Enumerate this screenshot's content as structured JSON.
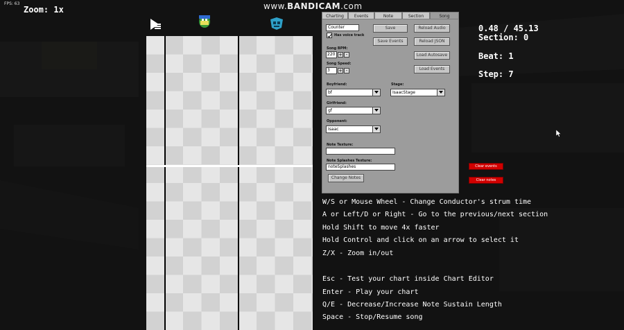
{
  "hud": {
    "fps": "FPS: 63",
    "zoom": "Zoom: 1x",
    "watermark_prefix": "www.",
    "watermark_brand": "BANDICAM",
    "watermark_suffix": ".com"
  },
  "tabs": [
    "Charting",
    "Events",
    "Note",
    "Section",
    "Song"
  ],
  "song_tab": {
    "song_name_value": "Counter",
    "voice_track_label": "Has voice track",
    "save_label": "Save",
    "reload_audio_label": "Reload Audio",
    "save_events_label": "Save Events",
    "reload_json_label": "Reload JSON",
    "bpm_label": "Song BPM:",
    "bpm_value": "220",
    "load_autosave_label": "Load Autosave",
    "speed_label": "Song Speed:",
    "speed_value": "3",
    "load_events_label": "Load Events",
    "plus": "+",
    "minus": "-",
    "boyfriend_label": "Boyfriend:",
    "boyfriend_value": "bf",
    "stage_label": "Stage:",
    "stage_value": "IsaacStage",
    "girlfriend_label": "Girlfriend:",
    "girlfriend_value": "gf",
    "opponent_label": "Opponent:",
    "opponent_value": "Isaac",
    "note_texture_label": "Note Texture:",
    "note_texture_value": "",
    "splash_texture_label": "Note Splashes Texture:",
    "splash_texture_value": "noteSplashes",
    "change_notes_label": "Change Notes"
  },
  "stats": {
    "time": "0.48 / 45.13",
    "section": "Section: 0",
    "beat": "Beat: 1",
    "step": "Step: 7"
  },
  "clear_events_label": "Clear events",
  "clear_notes_label": "Clear notes",
  "help_lines": [
    "W/S or Mouse Wheel - Change Conductor's strum time",
    "A or Left/D or Right - Go to the previous/next section",
    "Hold Shift to move 4x faster",
    "Hold Control and click on an arrow to select it",
    "Z/X - Zoom in/out",
    "Esc - Test your chart inside Chart Editor",
    "Enter - Play your chart",
    "Q/E - Decrease/Increase Note Sustain Length",
    "Space - Stop/Resume song"
  ],
  "colors": {
    "background": "#121212",
    "panel": "#9c9c9c",
    "danger": "#d10000"
  },
  "icons": {
    "events": "events-icon",
    "player": "boyfriend-health-icon",
    "opponent": "opponent-health-icon",
    "cursor": "mouse-cursor-icon"
  }
}
